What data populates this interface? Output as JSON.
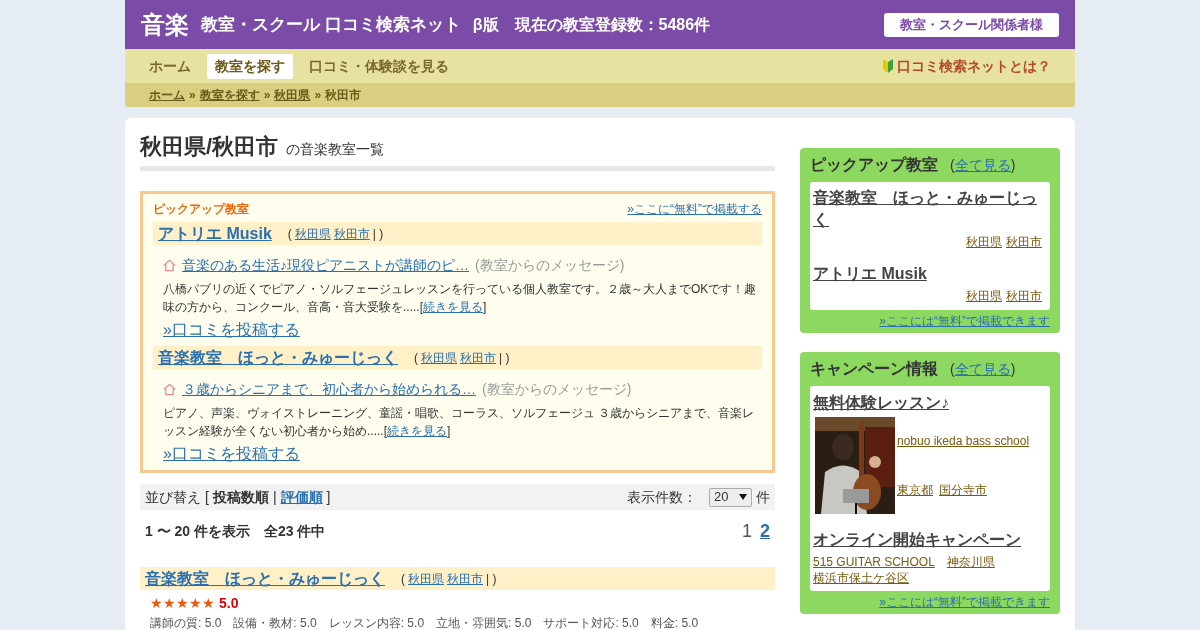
{
  "header": {
    "logo": "音楽",
    "title": "教室・スクール 口コミ検索ネット",
    "beta": "β版",
    "count": "現在の教室登録数：5486件",
    "button": "教室・スクール関係者様"
  },
  "nav": {
    "items": [
      {
        "label": "ホーム",
        "selected": false
      },
      {
        "label": "教室を探す",
        "selected": true
      },
      {
        "label": "口コミ・体験談を見る",
        "selected": false
      }
    ],
    "about": "口コミ検索ネットとは？"
  },
  "breadcrumb": {
    "separator": "»",
    "items": [
      {
        "label": "ホーム",
        "kind": "link"
      },
      {
        "label": "教室を探す",
        "kind": "link"
      },
      {
        "label": "秋田県",
        "kind": "link"
      },
      {
        "label": "秋田市",
        "kind": "current"
      }
    ]
  },
  "page_title": {
    "main": "秋田県/秋田市",
    "sub": "の音楽教室一覧"
  },
  "pickup": {
    "title": "ピックアップ教室",
    "free_link": "»ここに“無料”で掲載する",
    "schools": [
      {
        "name": "アトリエ Musik",
        "open": "(",
        "pref": "秋田県",
        "city": "秋田市",
        "close": "| )",
        "message": "音楽のある生活♪現役ピアニストが講師のピ…",
        "note": "(教室からのメッセージ)",
        "description": "八橋パブリの近くでピアノ・ソルフェージュレッスンを行っている個人教室です。２歳～大人までOKです！趣味の方から、コンクール、音高・音大受験を.....",
        "more_open": "[",
        "more": "続きを見る",
        "more_close": "]",
        "review": "»口コミを投稿する"
      },
      {
        "name": "音楽教室　ほっと・みゅーじっく",
        "open": "(",
        "pref": "秋田県",
        "city": "秋田市",
        "close": "| )",
        "message": "３歳からシニアまで、初心者から始められる…",
        "note": "(教室からのメッセージ)",
        "description": "ピアノ、声楽、ヴォイストレーニング、童謡・唱歌、コーラス、ソルフェージュ ３歳からシニアまで、音楽レッスン経験が全くない初心者から始め.....",
        "more_open": "[",
        "more": "続きを見る",
        "more_close": "]",
        "review": "»口コミを投稿する"
      }
    ]
  },
  "sort": {
    "label": "並び替え",
    "open": "[",
    "separator": "|",
    "close": "]",
    "options": [
      {
        "label": "投稿数順",
        "selected": true
      },
      {
        "label": "評価順",
        "selected": false
      }
    ],
    "per_page_label": "表示件数：",
    "per_page": "20",
    "per_page_unit": "件"
  },
  "summary": "1 〜 20 件を表示　全23 件中",
  "pages": [
    {
      "label": "1",
      "selected": true
    },
    {
      "label": "2",
      "selected": false
    }
  ],
  "results": [
    {
      "name": "音楽教室　ほっと・みゅーじっく",
      "open": "(",
      "pref": "秋田県",
      "city": "秋田市",
      "close": "| )",
      "stars": 5,
      "score": "5.0",
      "ratings": "講師の質: 5.0　設備・教材: 5.0　レッスン内容: 5.0　立地・雰囲気: 5.0　サポート対応: 5.0　料金: 5.0"
    }
  ],
  "sidebar": {
    "pickup": {
      "title": "ピックアップ教室",
      "all_open": "(",
      "all": "全て見る",
      "all_close": ")",
      "items": [
        {
          "name": "音楽教室　ほっと・みゅーじっく",
          "pref": "秋田県",
          "city": "秋田市"
        },
        {
          "name": "アトリエ Musik",
          "pref": "秋田県",
          "city": "秋田市"
        }
      ],
      "footer": "»ここには“無料”で掲載できます"
    },
    "campaign": {
      "title": "キャンペーン情報",
      "all_open": "(",
      "all": "全て見る",
      "all_close": ")",
      "items": [
        {
          "title": "無料体験レッスン♪",
          "school": "nobuo ikeda bass school",
          "pref": "東京都",
          "city": "国分寺市"
        },
        {
          "kind": "text",
          "title": "オンライン開始キャンペーン",
          "school": "515 GUITAR SCHOOL",
          "pref": "神奈川県",
          "city": "横浜市保土ケ谷区"
        }
      ],
      "footer": "»ここには“無料”で掲載できます"
    }
  }
}
